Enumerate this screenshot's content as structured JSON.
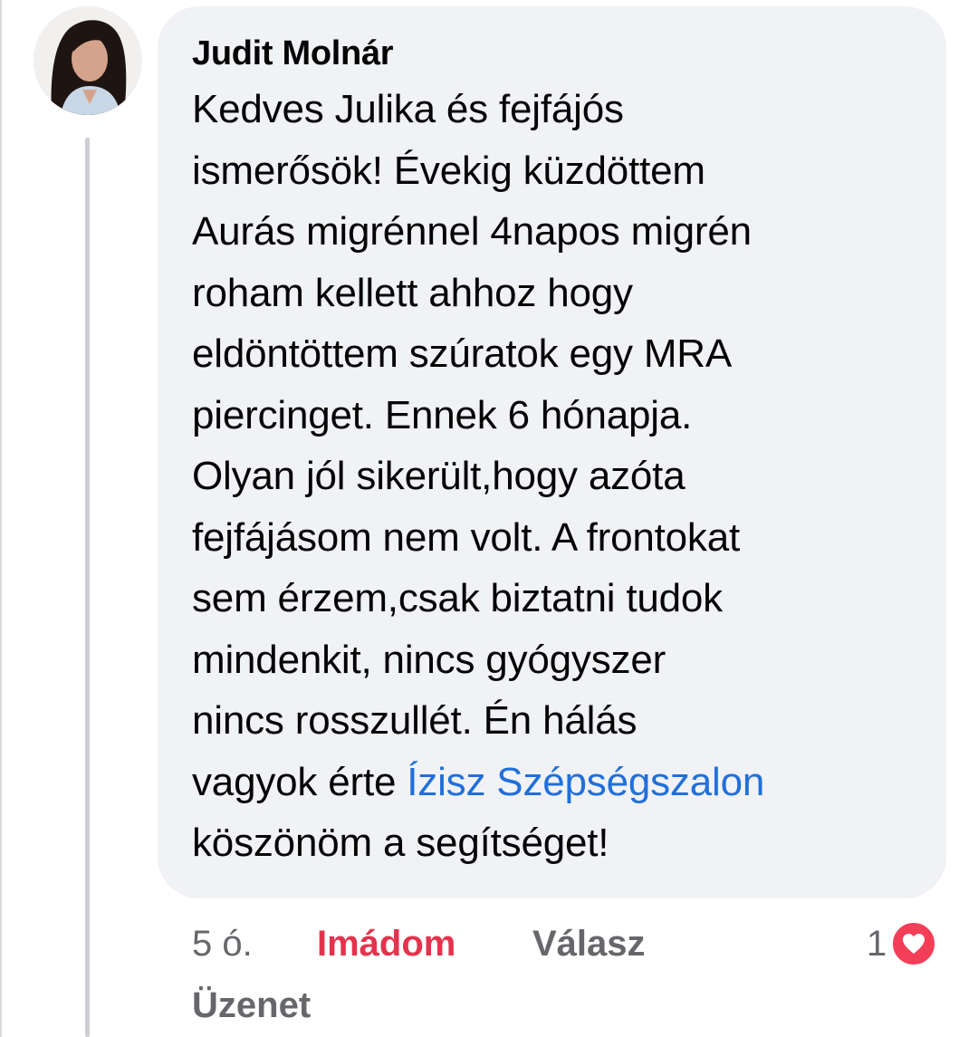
{
  "comment": {
    "author": "Judit Molnár",
    "avatar_alt": "avatar",
    "body_lines": [
      "Kedves Julika és fejfájós",
      "ismerősök! Évekig küzdöttem",
      "Aurás migrénnel 4napos migrén",
      "roham kellett ahhoz hogy",
      "eldöntöttem szúratok egy MRA",
      "piercinget. Ennek 6 hónapja.",
      "Olyan jól sikerült,hogy azóta",
      "fejfájásom nem volt. A frontokat",
      "sem érzem,csak biztatni tudok",
      "mindenkit, nincs gyógyszer",
      "nincs rosszullét. Én hálás"
    ],
    "body_line_12_prefix": "vagyok érte ",
    "mention": "Ízisz Szépségszalon",
    "body_last_line": "köszönöm a segítséget!"
  },
  "actions": {
    "time": "5 ó.",
    "love_label": "Imádom",
    "reply_label": "Válasz",
    "message_label": "Üzenet"
  },
  "reactions": {
    "count": "1",
    "icon": "heart-icon",
    "color": "#f33e58"
  },
  "colors": {
    "bubble": "#f0f2f5",
    "love": "#e4334d",
    "mention": "#216fdb",
    "muted": "#65676b"
  }
}
